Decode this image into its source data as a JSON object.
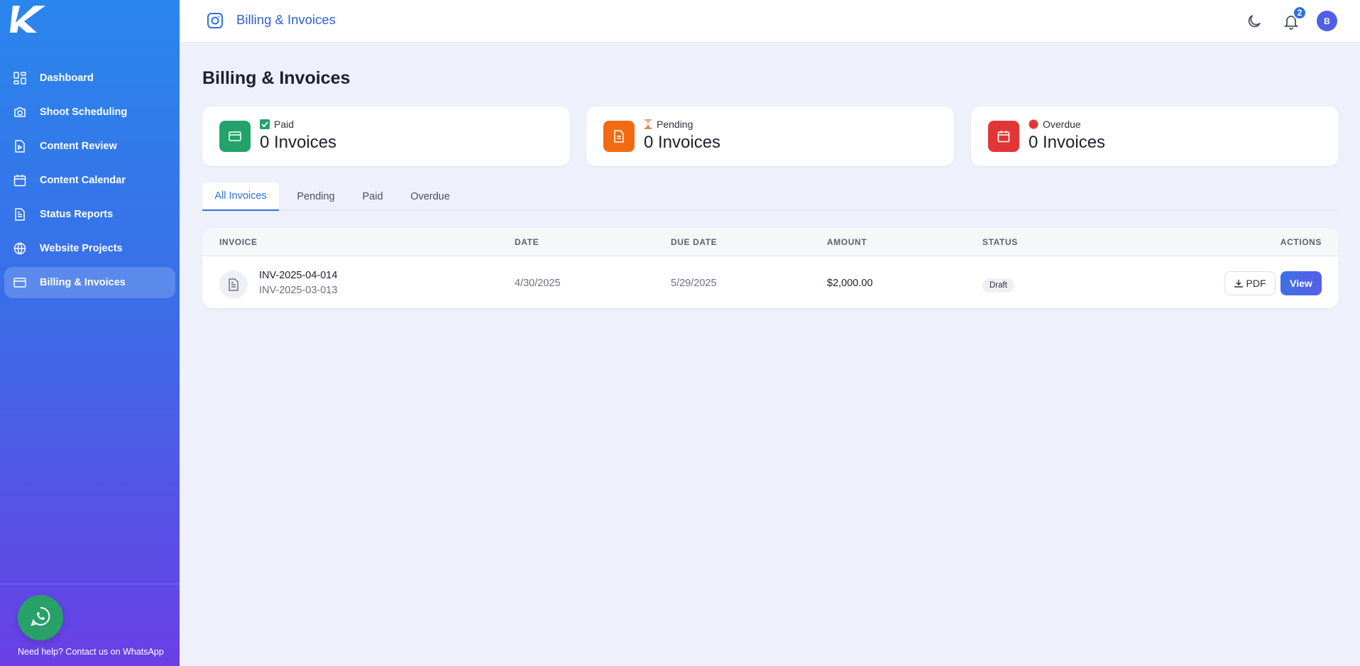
{
  "sidebar": {
    "items": [
      {
        "label": "Dashboard",
        "icon": "dashboard-icon"
      },
      {
        "label": "Shoot Scheduling",
        "icon": "camera-icon"
      },
      {
        "label": "Content Review",
        "icon": "play-document-icon"
      },
      {
        "label": "Content Calendar",
        "icon": "calendar-icon"
      },
      {
        "label": "Status Reports",
        "icon": "document-icon"
      },
      {
        "label": "Website Projects",
        "icon": "globe-icon"
      },
      {
        "label": "Billing & Invoices",
        "icon": "credit-card-icon",
        "active": true
      }
    ],
    "help_text": "Need help? Contact us on WhatsApp"
  },
  "topbar": {
    "title": "Billing & Invoices",
    "notifications_count": "2",
    "avatar_initial": "B"
  },
  "page": {
    "title": "Billing & Invoices"
  },
  "cards": [
    {
      "label": "Paid",
      "value": "0 Invoices",
      "color": "#21a36b"
    },
    {
      "label": "Pending",
      "value": "0 Invoices",
      "color": "#f26b12"
    },
    {
      "label": "Overdue",
      "value": "0 Invoices",
      "color": "#e23636"
    }
  ],
  "tabs": [
    "All Invoices",
    "Pending",
    "Paid",
    "Overdue"
  ],
  "table": {
    "headers": [
      "INVOICE",
      "DATE",
      "DUE DATE",
      "AMOUNT",
      "STATUS",
      "ACTIONS"
    ],
    "rows": [
      {
        "invoice_number": "INV-2025-04-014",
        "invoice_ref": "INV-2025-03-013",
        "date": "4/30/2025",
        "due_date": "5/29/2025",
        "amount": "$2,000.00",
        "status": "Draft",
        "pdf_label": "PDF",
        "view_label": "View"
      }
    ]
  },
  "colors": {
    "accent": "#2f6fe4",
    "sidebar_top": "#2a86ec",
    "sidebar_bottom": "#6a3fe6",
    "whatsapp": "#27a168"
  }
}
